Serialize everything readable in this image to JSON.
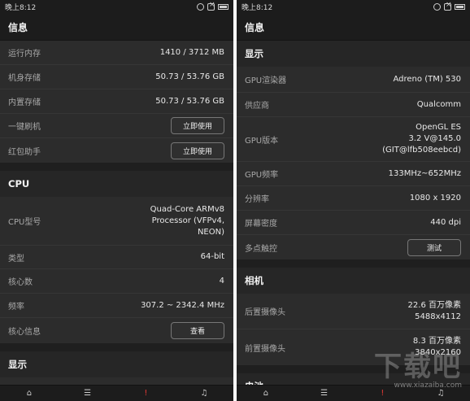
{
  "left": {
    "status": {
      "time": "晚上8:12"
    },
    "title": "信息",
    "rows1": [
      {
        "label": "运行内存",
        "value": "1410 / 3712 MB"
      },
      {
        "label": "机身存储",
        "value": "50.73 / 53.76 GB"
      },
      {
        "label": "内置存储",
        "value": "50.73 / 53.76 GB"
      },
      {
        "label": "一键刷机",
        "button": "立即使用"
      },
      {
        "label": "红包助手",
        "button": "立即使用"
      }
    ],
    "cpu_header": "CPU",
    "cpu_rows": [
      {
        "label": "CPU型号",
        "value_lines": [
          "Quad-Core ARMv8",
          "Processor (VFPv4,",
          "NEON)"
        ]
      },
      {
        "label": "类型",
        "value": "64-bit"
      },
      {
        "label": "核心数",
        "value": "4"
      },
      {
        "label": "频率",
        "value": "307.2 ~ 2342.4 MHz"
      },
      {
        "label": "核心信息",
        "button": "查看"
      }
    ],
    "display_header": "显示"
  },
  "right": {
    "status": {
      "time": "晚上8:12"
    },
    "title": "信息",
    "display_header": "显示",
    "display_rows": [
      {
        "label": "GPU渲染器",
        "value": "Adreno (TM) 530"
      },
      {
        "label": "供应商",
        "value": "Qualcomm"
      },
      {
        "label": "GPU版本",
        "value_lines": [
          "OpenGL ES",
          "3.2 V@145.0",
          "(GIT@lfb508eebcd)"
        ]
      },
      {
        "label": "GPU频率",
        "value": "133MHz~652MHz"
      },
      {
        "label": "分辨率",
        "value": "1080 x 1920"
      },
      {
        "label": "屏幕密度",
        "value": "440 dpi"
      },
      {
        "label": "多点触控",
        "button": "测试"
      }
    ],
    "camera_header": "相机",
    "camera_rows": [
      {
        "label": "后置摄像头",
        "value_lines": [
          "22.6 百万像素",
          "5488x4112"
        ]
      },
      {
        "label": "前置摄像头",
        "value_lines": [
          "8.3 百万像素",
          "3840x2160"
        ]
      }
    ],
    "battery_header": "电池"
  },
  "nav": {
    "icons": [
      "home-icon",
      "list-icon",
      "alert-icon",
      "bell-icon"
    ],
    "glyphs": [
      "⌂",
      "☰",
      "!",
      "♫"
    ]
  },
  "watermark": {
    "big": "下载吧",
    "small": "www.xiazaiba.com"
  }
}
